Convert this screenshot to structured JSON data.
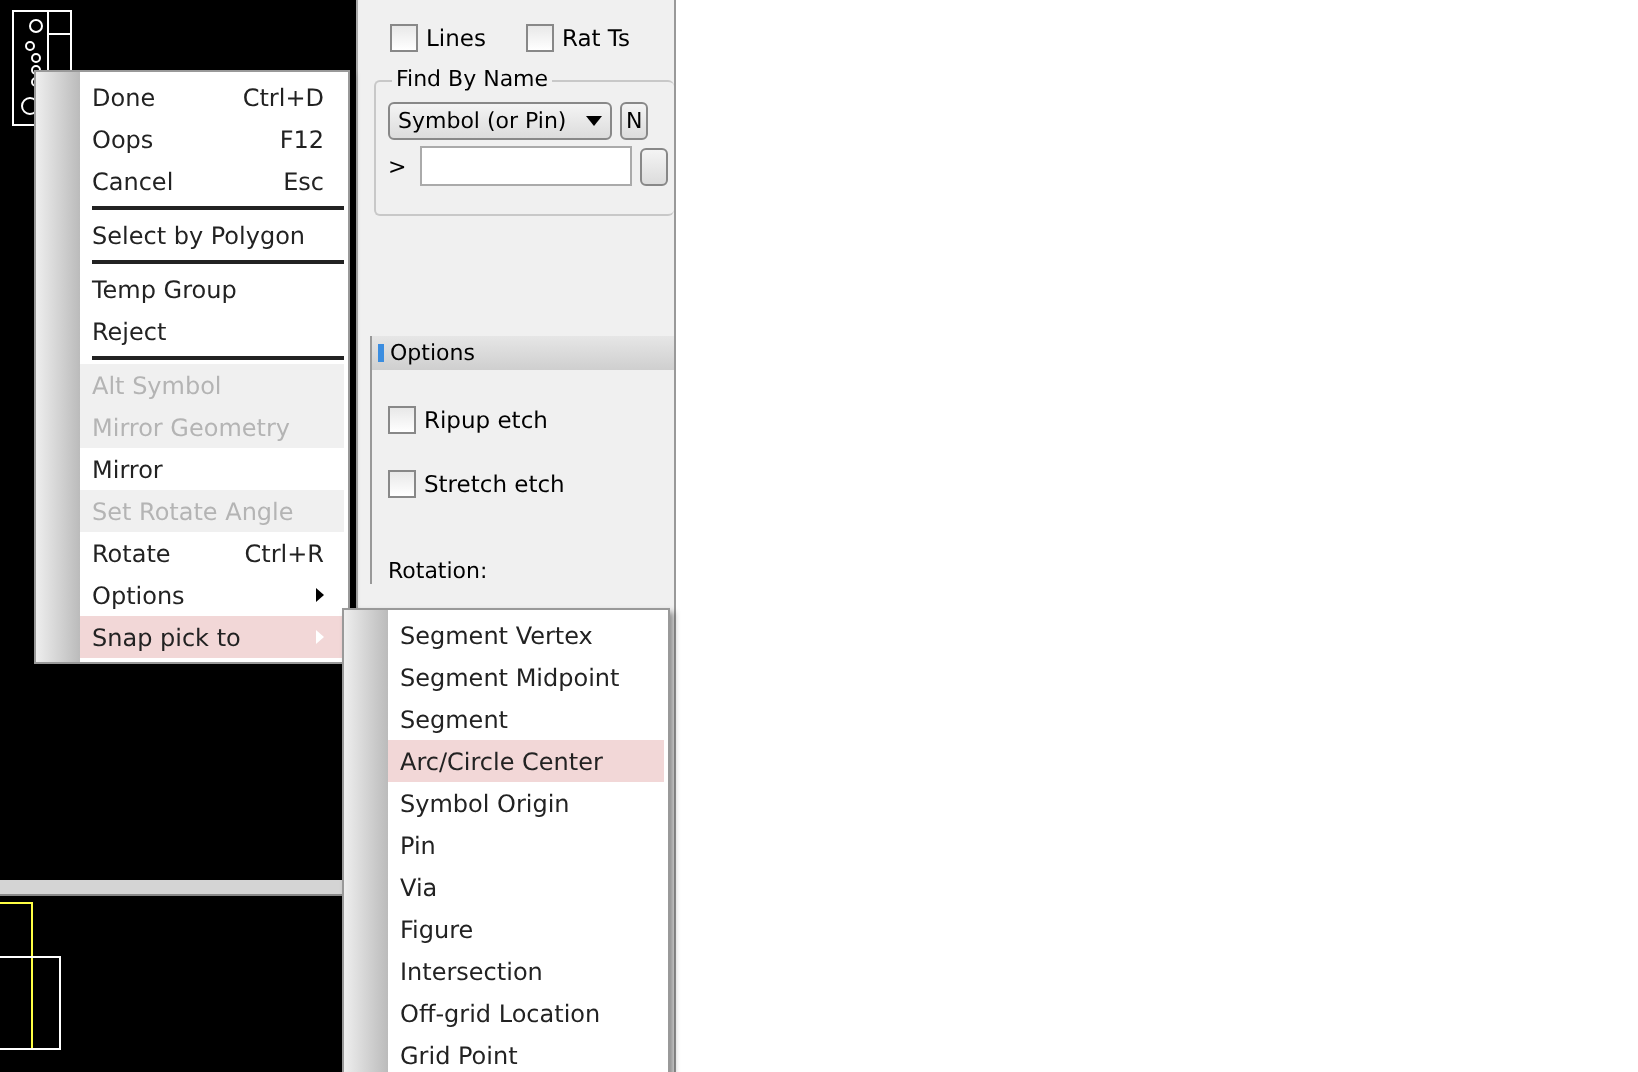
{
  "panel": {
    "top_checkboxes": [
      {
        "label": "Lines",
        "checked": false
      },
      {
        "label": "Rat Ts",
        "checked": false
      }
    ],
    "find_by_name": {
      "title": "Find By Name",
      "dropdown": "Symbol (or Pin)",
      "button": "N",
      "prompt": ">"
    },
    "options": {
      "title": "Options",
      "checkboxes": [
        {
          "label": "Ripup etch",
          "checked": false
        },
        {
          "label": "Stretch etch",
          "checked": false
        }
      ],
      "rotation_label": "Rotation:"
    }
  },
  "context_menu": [
    {
      "kind": "item",
      "label": "Done",
      "shortcut": "Ctrl+D",
      "disabled": false,
      "selected": false
    },
    {
      "kind": "item",
      "label": "Oops",
      "shortcut": "F12",
      "disabled": false,
      "selected": false
    },
    {
      "kind": "item",
      "label": "Cancel",
      "shortcut": "Esc",
      "disabled": false,
      "selected": false
    },
    {
      "kind": "separator"
    },
    {
      "kind": "item",
      "label": "Select by Polygon",
      "disabled": false,
      "selected": false
    },
    {
      "kind": "separator"
    },
    {
      "kind": "item",
      "label": "Temp Group",
      "disabled": false,
      "selected": false
    },
    {
      "kind": "item",
      "label": "Reject",
      "disabled": false,
      "selected": false
    },
    {
      "kind": "separator"
    },
    {
      "kind": "item",
      "label": "Alt Symbol",
      "disabled": true,
      "selected": false
    },
    {
      "kind": "item",
      "label": "Mirror Geometry",
      "disabled": true,
      "selected": false
    },
    {
      "kind": "item",
      "label": "Mirror",
      "disabled": false,
      "selected": false
    },
    {
      "kind": "item",
      "label": "Set Rotate Angle",
      "disabled": true,
      "selected": false
    },
    {
      "kind": "item",
      "label": "Rotate",
      "shortcut": "Ctrl+R",
      "disabled": false,
      "selected": false
    },
    {
      "kind": "submenu",
      "label": "Options",
      "disabled": false,
      "selected": false
    },
    {
      "kind": "submenu",
      "label": "Snap pick to",
      "disabled": false,
      "selected": true
    }
  ],
  "submenu": [
    {
      "label": "Segment Vertex",
      "selected": false
    },
    {
      "label": "Segment Midpoint",
      "selected": false
    },
    {
      "label": "Segment",
      "selected": false
    },
    {
      "label": "Arc/Circle Center",
      "selected": true
    },
    {
      "label": "Symbol Origin",
      "selected": false
    },
    {
      "label": "Pin",
      "selected": false
    },
    {
      "label": "Via",
      "selected": false
    },
    {
      "label": "Figure",
      "selected": false
    },
    {
      "label": "Intersection",
      "selected": false
    },
    {
      "label": "Off-grid Location",
      "selected": false
    },
    {
      "label": "Grid Point",
      "selected": false
    }
  ]
}
